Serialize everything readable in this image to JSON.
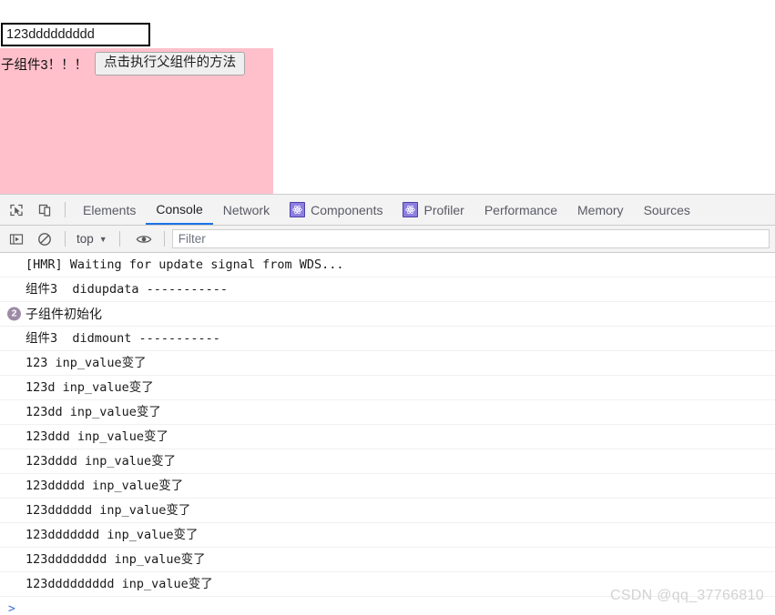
{
  "page": {
    "input": {
      "value": "123ddddddddd",
      "placeholder": ""
    },
    "child_label": "子组件3！！！",
    "parent_method_button": "点击执行父组件的方法"
  },
  "devtools": {
    "tabs": [
      {
        "label": "Elements",
        "icon": "",
        "active": false
      },
      {
        "label": "Console",
        "icon": "",
        "active": true
      },
      {
        "label": "Network",
        "icon": "",
        "active": false
      },
      {
        "label": "Components",
        "icon": "react-icon",
        "active": false
      },
      {
        "label": "Profiler",
        "icon": "react-icon",
        "active": false
      },
      {
        "label": "Performance",
        "icon": "",
        "active": false
      },
      {
        "label": "Memory",
        "icon": "",
        "active": false
      },
      {
        "label": "Sources",
        "icon": "",
        "active": false
      }
    ],
    "tab_icons": {
      "inspect": "inspect-element-icon",
      "device": "device-toolbar-icon"
    },
    "toolbar": {
      "sidebar_toggle": "console-sidebar-icon",
      "clear_console": "clear-console-icon",
      "context": "top",
      "context_caret": "▼",
      "live_expression": "eye-icon",
      "filter_placeholder": "Filter",
      "filter_value": ""
    },
    "messages": [
      {
        "text": "[HMR] Waiting for update signal from WDS...",
        "badge": ""
      },
      {
        "text": "组件3  didupdata -----------",
        "badge": ""
      },
      {
        "text": "子组件初始化",
        "badge": "2"
      },
      {
        "text": "组件3  didmount -----------",
        "badge": ""
      },
      {
        "text": "123 inp_value变了",
        "badge": ""
      },
      {
        "text": "123d inp_value变了",
        "badge": ""
      },
      {
        "text": "123dd inp_value变了",
        "badge": ""
      },
      {
        "text": "123ddd inp_value变了",
        "badge": ""
      },
      {
        "text": "123dddd inp_value变了",
        "badge": ""
      },
      {
        "text": "123ddddd inp_value变了",
        "badge": ""
      },
      {
        "text": "123dddddd inp_value变了",
        "badge": ""
      },
      {
        "text": "123ddddddd inp_value变了",
        "badge": ""
      },
      {
        "text": "123dddddddd inp_value变了",
        "badge": ""
      },
      {
        "text": "123ddddddddd inp_value变了",
        "badge": ""
      }
    ],
    "prompt": ">"
  },
  "watermark": "CSDN @qq_37766810",
  "colors": {
    "pink_block": "#ffc0cb",
    "active_tab_underline": "#1a73e8",
    "react_icon": "#8c7fe0",
    "badge": "#9d8ba6",
    "watermark": "#d2d2d2"
  }
}
